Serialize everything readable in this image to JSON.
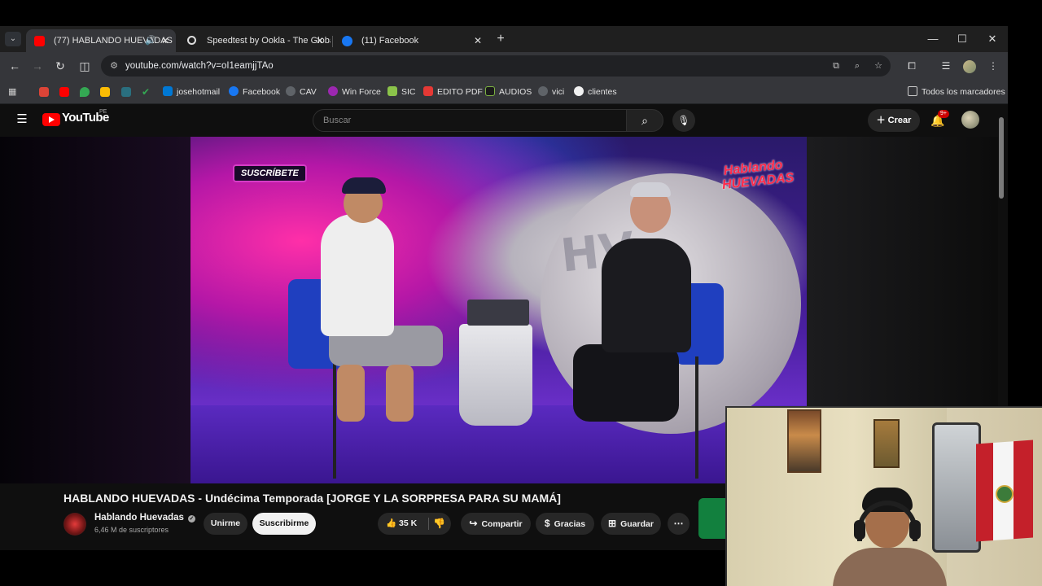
{
  "browser": {
    "tabs": [
      {
        "title": "(77) HABLANDO HUEVADAS",
        "favicon_color": "#ff0000",
        "active": true,
        "audio": true
      },
      {
        "title": "Speedtest by Ookla - The Global",
        "favicon_color": "#ffffff",
        "active": false
      },
      {
        "title": "(11) Facebook",
        "favicon_color": "#1877f2",
        "active": false
      }
    ],
    "url": "youtube.com/watch?v=oI1eamjjTAo",
    "bookmarks": [
      {
        "label": "josehotmail"
      },
      {
        "label": "Facebook"
      },
      {
        "label": "CAV"
      },
      {
        "label": "Win Force"
      },
      {
        "label": "SIC"
      },
      {
        "label": "EDITO PDF"
      },
      {
        "label": "AUDIOS"
      },
      {
        "label": "vici"
      },
      {
        "label": "clientes"
      }
    ],
    "all_bookmarks": "Todos los marcadores"
  },
  "youtube": {
    "logo_text": "YouTube",
    "region": "PE",
    "search_placeholder": "Buscar",
    "create_label": "Crear",
    "notification_count": "9+"
  },
  "video": {
    "overlay_sticker": "SUSCRÍBETE",
    "overlay_logo": "Hablando HUEVADAS",
    "title": "HABLANDO HUEVADAS - Undécima Temporada [JORGE Y LA SORPRESA PARA SU MAMÁ]",
    "channel_name": "Hablando Huevadas",
    "subscribers": "6,46 M de suscriptores",
    "join_label": "Unirme",
    "subscribe_label": "Suscribirme",
    "likes": "35 K",
    "share_label": "Compartir",
    "thanks_label": "Gracias",
    "save_label": "Guardar"
  },
  "colors": {
    "accent": "#ff0000",
    "page_bg": "#0f0f0f",
    "chrome_toolbar": "#35363a"
  }
}
